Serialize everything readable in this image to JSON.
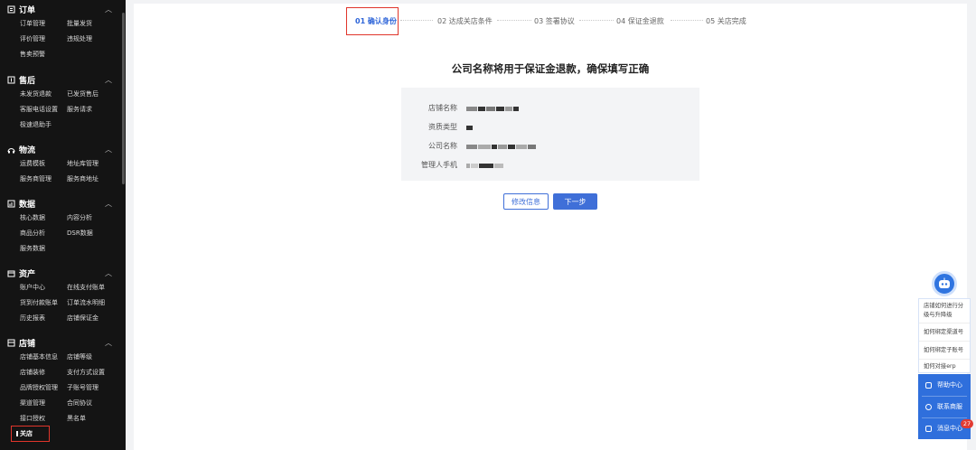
{
  "sidebar": {
    "sections": [
      {
        "title": "订单",
        "icon": "order-icon",
        "items": [
          "订单管理",
          "批量发货",
          "评价管理",
          "违规处理",
          "售卖预警"
        ]
      },
      {
        "title": "售后",
        "icon": "after-sales-icon",
        "items": [
          "未发货退款",
          "已发货售后",
          "客服电话设置",
          "服务请求",
          "极速退助手"
        ]
      },
      {
        "title": "物流",
        "icon": "logistics-icon",
        "items": [
          "运费模板",
          "地址库管理",
          "服务商管理",
          "服务商地址"
        ]
      },
      {
        "title": "数据",
        "icon": "data-icon",
        "items": [
          "核心数据",
          "内容分析",
          "商品分析",
          "DSR数据",
          "服务数据"
        ]
      },
      {
        "title": "资产",
        "icon": "assets-icon",
        "items": [
          "账户中心",
          "在线支付账单",
          "货到付款账单",
          "订单流水明细",
          "历史报表",
          "店铺保证金"
        ]
      },
      {
        "title": "店铺",
        "icon": "store-icon",
        "items": [
          "店铺基本信息",
          "店铺等级",
          "店铺装修",
          "支付方式设置",
          "品牌授权管理",
          "子账号管理",
          "渠道管理",
          "合同协议",
          "接口授权",
          "黑名单"
        ]
      }
    ],
    "close_store": "关店"
  },
  "steps": [
    {
      "label": "01 确认身份",
      "active": true
    },
    {
      "label": "02 达成关店条件",
      "active": false
    },
    {
      "label": "03 签署协议",
      "active": false
    },
    {
      "label": "04 保证金退款",
      "active": false
    },
    {
      "label": "05 关店完成",
      "active": false
    }
  ],
  "heading": "公司名称将用于保证金退款，确保填写正确",
  "info": [
    {
      "label": "店铺名称"
    },
    {
      "label": "资质类型"
    },
    {
      "label": "公司名称"
    },
    {
      "label": "管理人手机"
    }
  ],
  "buttons": {
    "edit": "修改信息",
    "next": "下一步"
  },
  "help": {
    "questions": [
      "店铺如何进行分级与升降级",
      "如何绑定渠道号",
      "如何绑定子账号",
      "如何对接erp"
    ],
    "actions": [
      "帮助中心",
      "联系商服",
      "消息中心"
    ],
    "badge": "27"
  },
  "colors": {
    "accent": "#2d64d8",
    "highlight": "#e0352b",
    "sidebar_bg": "#141414"
  }
}
